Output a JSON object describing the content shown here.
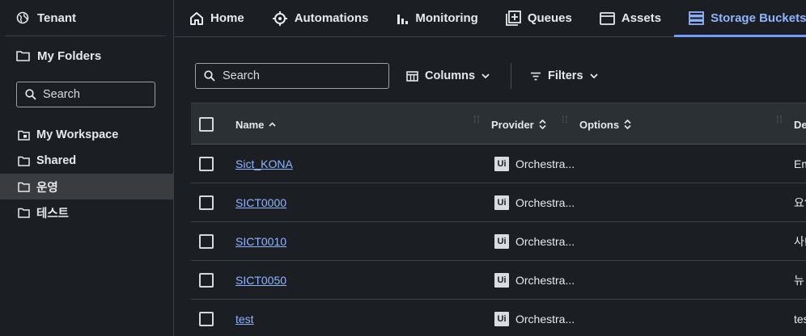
{
  "sidebar": {
    "tenant_label": "Tenant",
    "my_folders_label": "My Folders",
    "search_placeholder": "Search",
    "items": [
      {
        "label": "My Workspace",
        "icon": "workspace-folder-icon",
        "active": false
      },
      {
        "label": "Shared",
        "icon": "folder-icon",
        "active": false
      },
      {
        "label": "운영",
        "icon": "folder-icon",
        "active": true
      },
      {
        "label": "테스트",
        "icon": "folder-icon",
        "active": false
      }
    ]
  },
  "topnav": {
    "tabs": [
      {
        "label": "Home",
        "icon": "home-icon"
      },
      {
        "label": "Automations",
        "icon": "automations-icon"
      },
      {
        "label": "Monitoring",
        "icon": "monitoring-icon"
      },
      {
        "label": "Queues",
        "icon": "queues-icon"
      },
      {
        "label": "Assets",
        "icon": "assets-icon"
      },
      {
        "label": "Storage Buckets",
        "icon": "storage-buckets-icon",
        "active": true
      }
    ]
  },
  "toolbar": {
    "search_placeholder": "Search",
    "columns_label": "Columns",
    "filters_label": "Filters"
  },
  "table": {
    "headers": {
      "name": "Name",
      "provider": "Provider",
      "options": "Options",
      "description": "De"
    },
    "rows": [
      {
        "name": "Sict_KONA",
        "provider": "Orchestra...",
        "provider_badge": "Ui",
        "description": "Em"
      },
      {
        "name": "SICT0000",
        "provider": "Orchestra...",
        "provider_badge": "Ui",
        "description": "요?"
      },
      {
        "name": "SICT0010",
        "provider": "Orchestra...",
        "provider_badge": "Ui",
        "description": "사!"
      },
      {
        "name": "SICT0050",
        "provider": "Orchestra...",
        "provider_badge": "Ui",
        "description": "뉴"
      },
      {
        "name": "test",
        "provider": "Orchestra...",
        "provider_badge": "Ui",
        "description": "tes"
      }
    ]
  },
  "colors": {
    "accent": "#8fb4ff",
    "background": "#1b1f24",
    "header_bg": "#2b3035",
    "active_item_bg": "#3a3c40"
  }
}
